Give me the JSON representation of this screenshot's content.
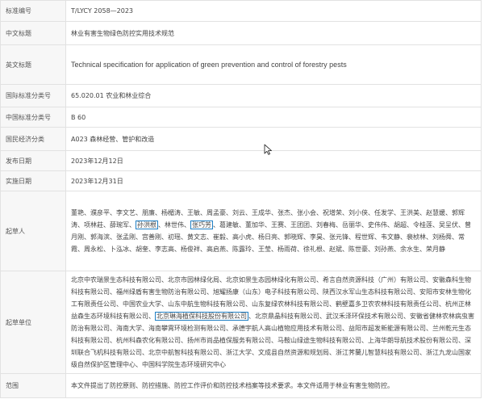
{
  "rows": {
    "std_no": {
      "label": "标准编号",
      "value": "T/LYCY 2058—2023"
    },
    "cn_title": {
      "label": "中文标题",
      "value": "林业有害生物绿色防控实用技术规范"
    },
    "en_title": {
      "label": "英文标题",
      "value": "Technical specification for application of green prevention and control of forestry pests"
    },
    "ics": {
      "label": "国际标准分类号",
      "value": "65.020.01 农业和林业综合"
    },
    "ccs": {
      "label": "中国标准分类号",
      "value": "B 60"
    },
    "econ": {
      "label": "国民经济分类",
      "value": "A023 森林经营、管护和改造"
    },
    "pub_date": {
      "label": "发布日期",
      "value": "2023年12月12日"
    },
    "impl_date": {
      "label": "实施日期",
      "value": "2023年12月31日"
    },
    "drafters": {
      "label": "起草人",
      "before": "董艳、濮彦平、李文艺、朋廉、杨楣涛、王敏、周孟豪、刘云、王成华、张杰、张小会、祝增荣、刘小侠、任发学、王洪美、赵慧媛、郭辉涛、项林莊、薛琬军、",
      "hl1": "孙洪根",
      "mid": "、林世伟、",
      "hl2": "张巧芳",
      "after": "、葛建敏、董加华、王赛、王团团、刘春梅、岳丽华、史伟伟、胡超、令桂莲、吴呈伏、曾月刚、郭海滨、张孟刚、宫善刚、初瑶、黄文志、崔毅、高小虎、杨日亮、郭晓辉、李昊、张元锋、程世辉、韦文静、裴桢林、刘杨舜、常霞、周永松、卜泓冰、胡奎、李志高、杨俊祥、高启燕、陈露玲、王莹、杨雨荷、徐礼根、赵斌、陈世豪、刘孙燕、余水生、荣月静"
    },
    "drafting_org": {
      "label": "起草单位",
      "before": "北京中农瑞景生态科技有限公司、北京市园林绿化局、北京如景生态园林绿化有限公司、希言自然资源科技（广州）有限公司、安徽森科生物科技有限公司、福州绿盾有害生物防治有限公司、旭耀扬康（山东）电子科技有限公司、陕西汉水军山生态科技有限公司、安阳市安林生物化工有限责任公司、中国农业大学、山东中航生物科技有限公司、山东复绿农林科技有限公司、鹤壁嘉多卫农农林科技有限责任公司、杭州正林益森生态环境科技有限公司、",
      "hl": "北京琳海植保科技股份有限公司",
      "after": "、北京鼎晶科技有限公司、武汉禾泽环保技术有限公司、安徽省健林农林病虫害防治有限公司、海南大学、海南攀霄环境检测有限公司、承德宇航人高山植物应用技术有限公司、益阳市超发新能源有限公司、兰州乾元生态科技有限公司、杭州科森农化有限公司、扬州市尚品植保服务有限公司、马鞍山绿途生物科技有限公司、上海华朗导航技术股份有限公司、深圳联合飞机科技有限公司、北京中航智科技有限公司、浙江大学、文成县自然资源和规划局、浙江荠蘭儿智慧科技有限公司、浙江九龙山国家级自然保护区管理中心、中国科学院生态环境研究中心"
    },
    "scope": {
      "label": "范围",
      "value": "本文件提出了防控原则、防控措施、防控工作评价和防控技术档案等技术要求。本文件适用于林业有害生物防控。"
    }
  },
  "colors": {
    "highlight_border": "#1f7fc4",
    "label_bg": "#f7f7f7",
    "grid": "#e2e2e2"
  },
  "icons": {
    "cursor": "mouse-pointer-icon"
  }
}
